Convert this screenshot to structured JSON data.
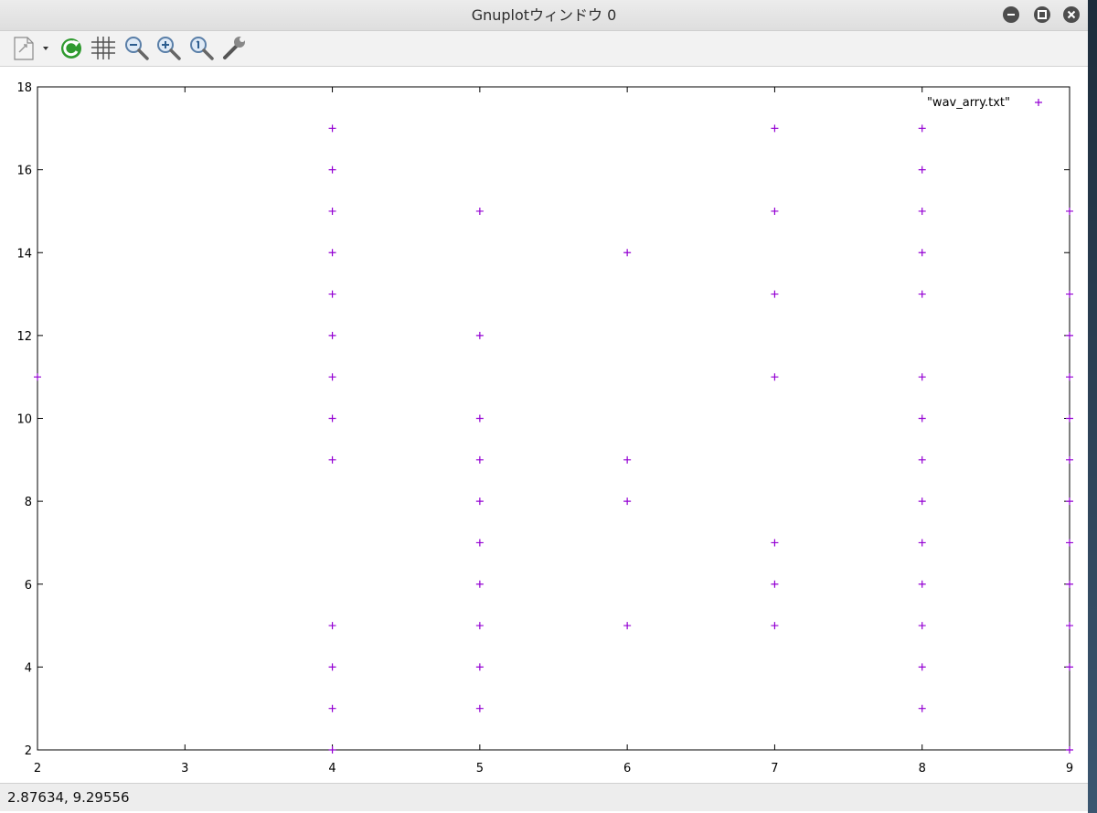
{
  "window": {
    "title": "Gnuplotウィンドウ 0"
  },
  "toolbar": {
    "items": [
      {
        "name": "export-icon"
      },
      {
        "name": "replot-icon"
      },
      {
        "name": "grid-icon"
      },
      {
        "name": "zoom-out-icon"
      },
      {
        "name": "zoom-in-icon"
      },
      {
        "name": "zoom-fit-icon"
      },
      {
        "name": "settings-wrench-icon"
      }
    ]
  },
  "status": {
    "coords": "2.87634,  9.29556"
  },
  "colors": {
    "points": "#9400d3",
    "axis": "#000000"
  },
  "chart_data": {
    "type": "scatter",
    "xlim": [
      2,
      9
    ],
    "ylim": [
      2,
      18
    ],
    "xticks": [
      2,
      3,
      4,
      5,
      6,
      7,
      8,
      9
    ],
    "yticks": [
      2,
      4,
      6,
      8,
      10,
      12,
      14,
      16,
      18
    ],
    "grid": false,
    "legend": "top-right",
    "series": [
      {
        "name": "\"wav_arry.txt\"",
        "points": [
          [
            2,
            11
          ],
          [
            4,
            2
          ],
          [
            4,
            3
          ],
          [
            4,
            4
          ],
          [
            4,
            5
          ],
          [
            4,
            9
          ],
          [
            4,
            10
          ],
          [
            4,
            11
          ],
          [
            4,
            12
          ],
          [
            4,
            13
          ],
          [
            4,
            14
          ],
          [
            4,
            15
          ],
          [
            4,
            16
          ],
          [
            4,
            17
          ],
          [
            5,
            3
          ],
          [
            5,
            4
          ],
          [
            5,
            5
          ],
          [
            5,
            6
          ],
          [
            5,
            7
          ],
          [
            5,
            8
          ],
          [
            5,
            9
          ],
          [
            5,
            10
          ],
          [
            5,
            12
          ],
          [
            5,
            15
          ],
          [
            6,
            5
          ],
          [
            6,
            8
          ],
          [
            6,
            9
          ],
          [
            6,
            14
          ],
          [
            7,
            5
          ],
          [
            7,
            6
          ],
          [
            7,
            7
          ],
          [
            7,
            11
          ],
          [
            7,
            13
          ],
          [
            7,
            15
          ],
          [
            7,
            17
          ],
          [
            8,
            3
          ],
          [
            8,
            4
          ],
          [
            8,
            5
          ],
          [
            8,
            6
          ],
          [
            8,
            7
          ],
          [
            8,
            8
          ],
          [
            8,
            9
          ],
          [
            8,
            10
          ],
          [
            8,
            11
          ],
          [
            8,
            13
          ],
          [
            8,
            14
          ],
          [
            8,
            15
          ],
          [
            8,
            16
          ],
          [
            8,
            17
          ],
          [
            9,
            2
          ],
          [
            9,
            4
          ],
          [
            9,
            5
          ],
          [
            9,
            6
          ],
          [
            9,
            7
          ],
          [
            9,
            8
          ],
          [
            9,
            9
          ],
          [
            9,
            10
          ],
          [
            9,
            11
          ],
          [
            9,
            12
          ],
          [
            9,
            13
          ],
          [
            9,
            15
          ]
        ]
      }
    ]
  }
}
